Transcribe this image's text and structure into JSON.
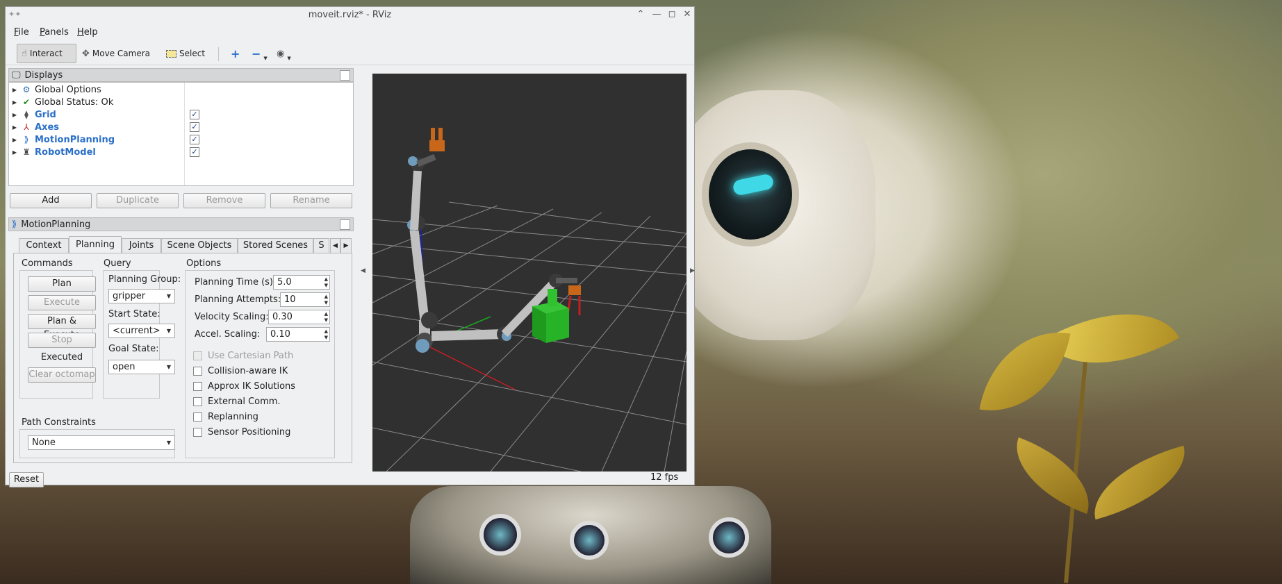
{
  "window": {
    "title": "moveit.rviz* - RViz",
    "controls": [
      "minimize",
      "maximize",
      "close"
    ]
  },
  "menu": [
    {
      "label": "File",
      "accel": "F",
      "rest": "ile"
    },
    {
      "label": "Panels",
      "accel": "P",
      "rest": "anels"
    },
    {
      "label": "Help",
      "accel": "H",
      "rest": "elp"
    }
  ],
  "toolbar": {
    "interact": "Interact",
    "move_camera": "Move Camera",
    "select": "Select"
  },
  "displays": {
    "title": "Displays",
    "items": [
      {
        "label": "Global Options",
        "icon": "gear-icon",
        "checked": null,
        "highlight": false
      },
      {
        "label": "Global Status: Ok",
        "icon": "check-icon",
        "checked": null,
        "highlight": false
      },
      {
        "label": "Grid",
        "icon": "grid-icon",
        "checked": true,
        "highlight": true
      },
      {
        "label": "Axes",
        "icon": "axes-icon",
        "checked": true,
        "highlight": true
      },
      {
        "label": "MotionPlanning",
        "icon": "motion-planning-icon",
        "checked": true,
        "highlight": true
      },
      {
        "label": "RobotModel",
        "icon": "robot-model-icon",
        "checked": true,
        "highlight": true
      }
    ],
    "buttons": {
      "add": "Add",
      "duplicate": "Duplicate",
      "remove": "Remove",
      "rename": "Rename"
    }
  },
  "motion_planning": {
    "title": "MotionPlanning",
    "tabs": [
      "Context",
      "Planning",
      "Joints",
      "Scene Objects",
      "Stored Scenes",
      "S"
    ],
    "active_tab": "Planning",
    "commands": {
      "title": "Commands",
      "plan": "Plan",
      "execute": "Execute",
      "plan_execute": "Plan & Execute",
      "stop": "Stop",
      "status": "Executed",
      "clear_octomap": "Clear octomap"
    },
    "query": {
      "title": "Query",
      "planning_group_label": "Planning Group:",
      "planning_group": "gripper",
      "start_state_label": "Start State:",
      "start_state": "<current>",
      "goal_state_label": "Goal State:",
      "goal_state": "open"
    },
    "options": {
      "title": "Options",
      "planning_time_label": "Planning Time (s):",
      "planning_time": "5.0",
      "planning_attempts_label": "Planning Attempts:",
      "planning_attempts": "10",
      "velocity_scaling_label": "Velocity Scaling:",
      "velocity_scaling": "0.30",
      "accel_scaling_label": "Accel. Scaling:",
      "accel_scaling": "0.10",
      "checkboxes": [
        {
          "label": "Use Cartesian Path",
          "checked": false,
          "disabled": true
        },
        {
          "label": "Collision-aware IK",
          "checked": false,
          "disabled": false
        },
        {
          "label": "Approx IK Solutions",
          "checked": false,
          "disabled": false
        },
        {
          "label": "External Comm.",
          "checked": false,
          "disabled": false
        },
        {
          "label": "Replanning",
          "checked": false,
          "disabled": false
        },
        {
          "label": "Sensor Positioning",
          "checked": false,
          "disabled": false
        }
      ]
    },
    "path_constraints": {
      "title": "Path Constraints",
      "value": "None"
    }
  },
  "footer": {
    "reset": "Reset",
    "fps": "12 fps"
  },
  "colors": {
    "viewport_bg": "#303030",
    "highlight_text": "#2a6fc9",
    "target_cube": "#1fa81f",
    "gripper": "#c8661a"
  }
}
